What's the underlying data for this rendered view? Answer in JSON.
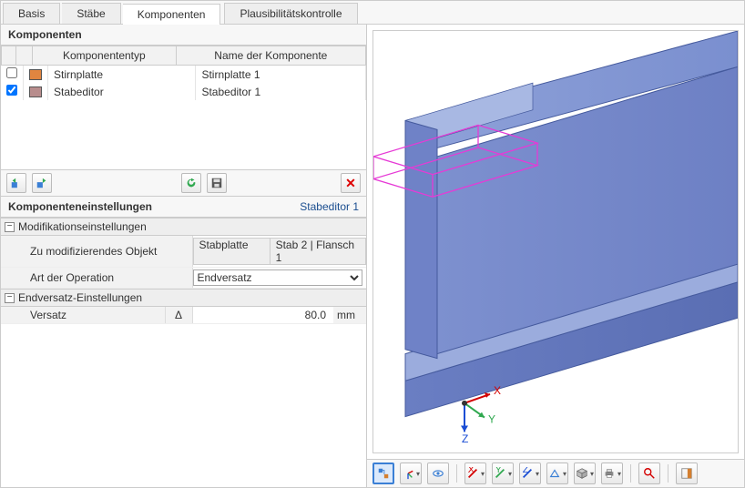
{
  "tabs": {
    "basis": "Basis",
    "staebe": "Stäbe",
    "komponenten": "Komponenten",
    "plaus": "Plausibilitätskontrolle",
    "activeIndex": 2
  },
  "componentsPanel": {
    "title": "Komponenten",
    "columns": {
      "type": "Komponententyp",
      "name": "Name der Komponente"
    },
    "rows": [
      {
        "checked": false,
        "color": "orange",
        "type": "Stirnplatte",
        "name": "Stirnplatte 1"
      },
      {
        "checked": true,
        "color": "mauve",
        "type": "Stabeditor",
        "name": "Stabeditor 1"
      }
    ],
    "toolbar": {
      "newLeft": "neu-links",
      "newRight": "neu-rechts",
      "reload": "neu-laden",
      "save": "speichern",
      "delete": "löschen"
    }
  },
  "settingsPanel": {
    "title": "Komponenteneinstellungen",
    "subject": "Stabeditor 1",
    "group1": {
      "title": "Modifikationseinstellungen",
      "rows": {
        "target_label": "Zu modifizierendes Objekt",
        "target_value_a": "Stabplatte",
        "target_value_b": "Stab 2 | Flansch 1",
        "op_label": "Art der Operation",
        "op_value": "Endversatz"
      }
    },
    "group2": {
      "title": "Endversatz-Einstellungen",
      "rows": {
        "offset_label": "Versatz",
        "offset_delta": "Δ",
        "offset_value": "80.0",
        "offset_unit": "mm"
      }
    }
  },
  "viewport": {
    "axes": {
      "x": "X",
      "y": "Y",
      "z": "Z"
    },
    "viewcube": "Ansichtswürfel"
  },
  "viewToolbar": {
    "tooltip_fit": "Alles anzeigen",
    "tooltip_print": "Drucken",
    "tooltip_find": "Suchen"
  }
}
